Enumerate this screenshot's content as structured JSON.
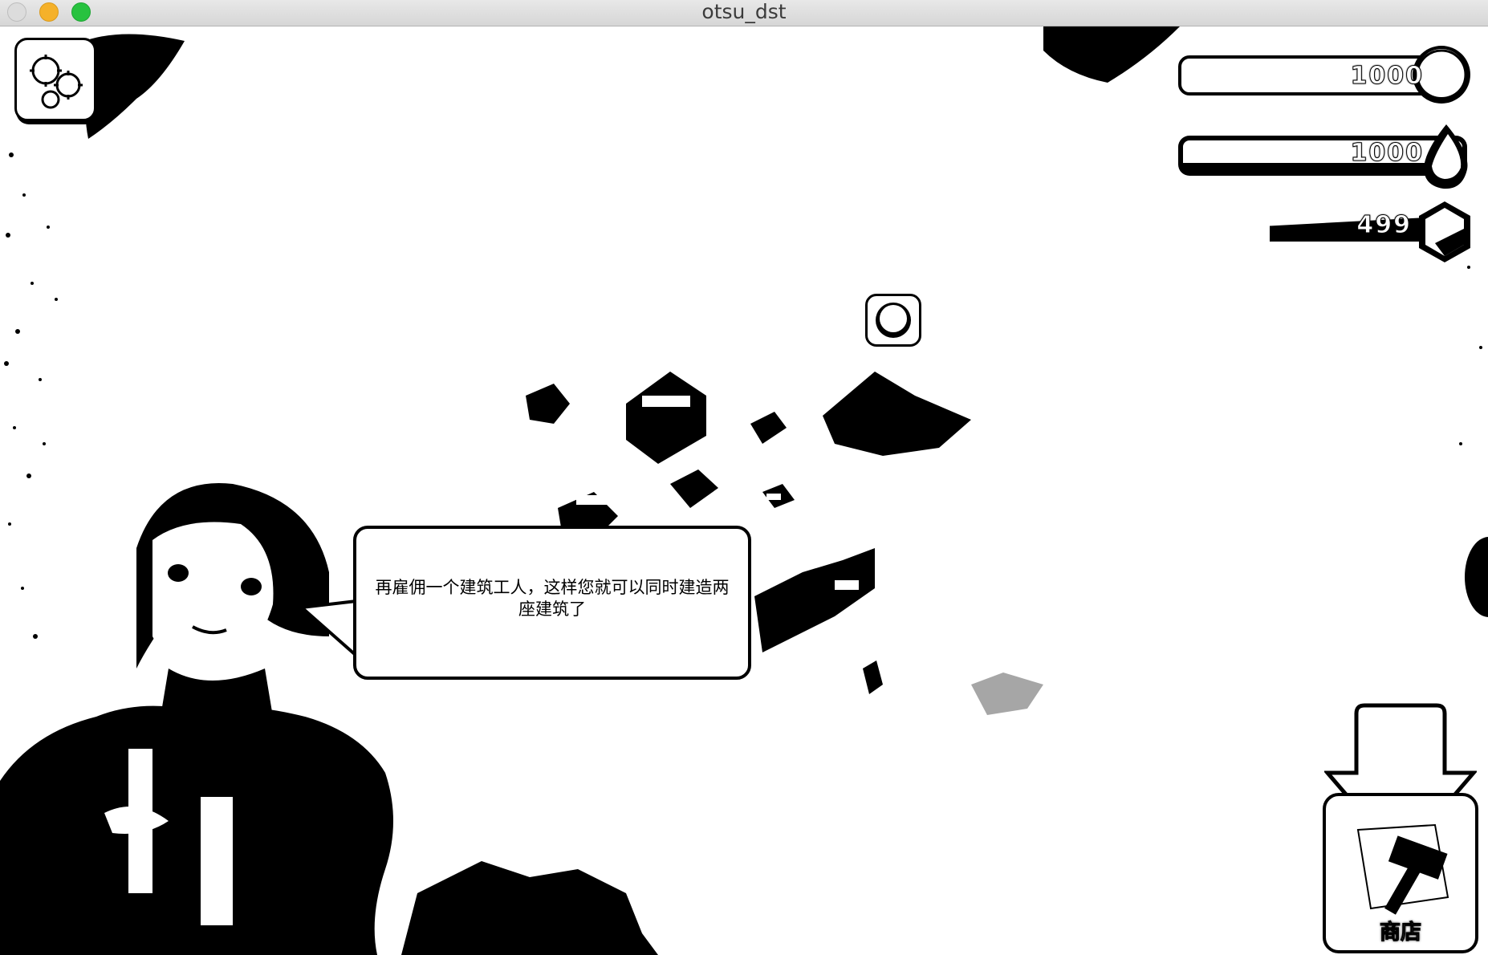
{
  "window": {
    "title": "otsu_dst"
  },
  "resources": {
    "gold": "1000",
    "elixir": "1000",
    "gems": "499",
    "gold_icon": "gold-coin-icon",
    "elixir_icon": "elixir-drop-icon",
    "gems_icon": "gem-icon"
  },
  "dialog": {
    "message": "再雇佣一个建筑工人，这样您就可以同时建造两座建筑了"
  },
  "toolbar": {
    "shop_label": "商店",
    "settings_icon": "gears-icon"
  }
}
